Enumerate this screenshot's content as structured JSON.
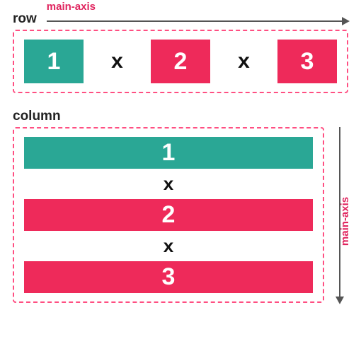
{
  "row": {
    "title": "row",
    "axis_label": "main-axis",
    "items": [
      "1",
      "2",
      "3"
    ],
    "separator": "x",
    "colors": {
      "teal": "#2aa795",
      "pink": "#ee2a5a"
    }
  },
  "column": {
    "title": "column",
    "axis_label": "main-axis",
    "items": [
      "1",
      "2",
      "3"
    ],
    "separator": "x"
  }
}
